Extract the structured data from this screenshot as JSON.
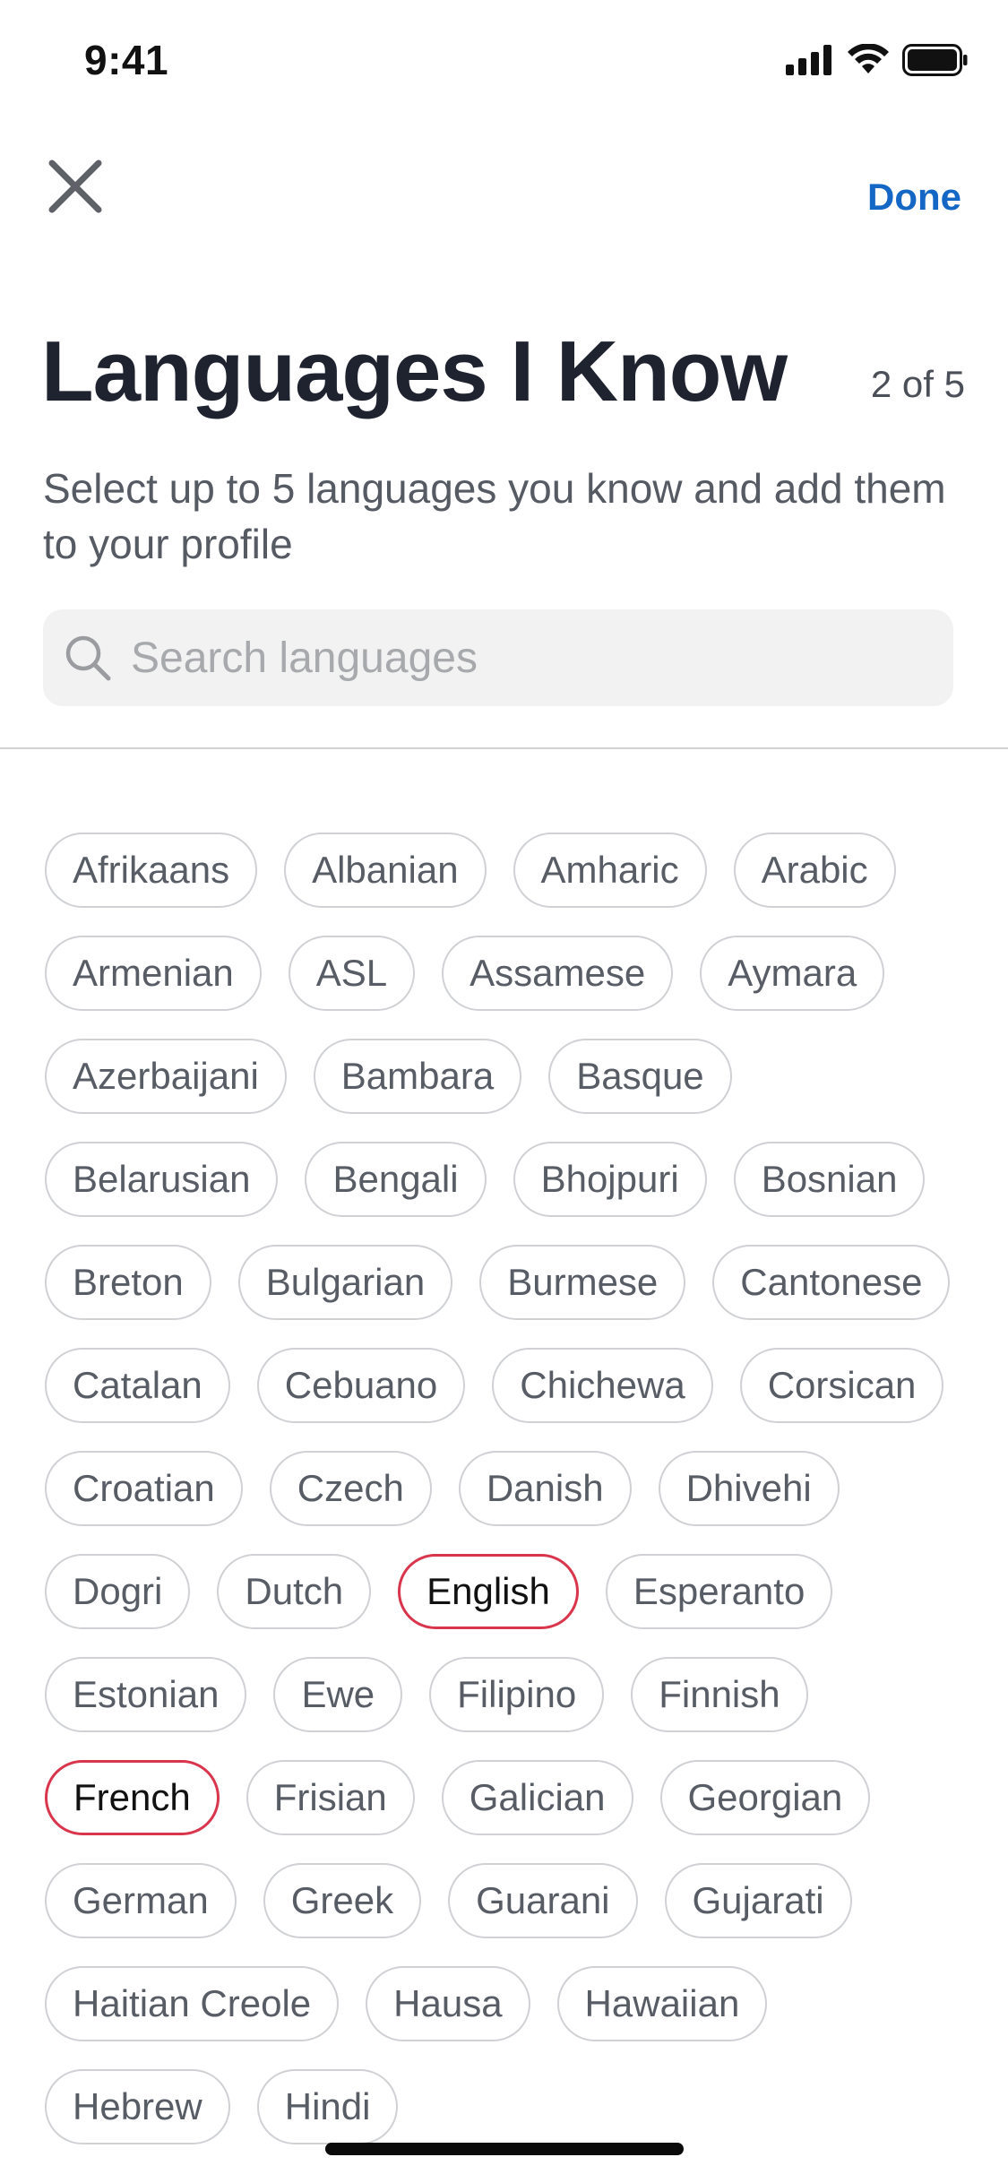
{
  "status_bar": {
    "time": "9:41"
  },
  "nav": {
    "done_label": "Done",
    "accent_color": "#1467c4"
  },
  "header": {
    "title": "Languages I Know",
    "counter": "2 of 5",
    "subtitle": "Select up to 5 languages you know and add them to your profile"
  },
  "search": {
    "placeholder": "Search languages",
    "value": ""
  },
  "selected_color": "#d9354c",
  "languages": [
    {
      "label": "Afrikaans",
      "selected": false
    },
    {
      "label": "Albanian",
      "selected": false
    },
    {
      "label": "Amharic",
      "selected": false
    },
    {
      "label": "Arabic",
      "selected": false
    },
    {
      "label": "Armenian",
      "selected": false
    },
    {
      "label": "ASL",
      "selected": false
    },
    {
      "label": "Assamese",
      "selected": false
    },
    {
      "label": "Aymara",
      "selected": false
    },
    {
      "label": "Azerbaijani",
      "selected": false
    },
    {
      "label": "Bambara",
      "selected": false
    },
    {
      "label": "Basque",
      "selected": false
    },
    {
      "label": "Belarusian",
      "selected": false
    },
    {
      "label": "Bengali",
      "selected": false
    },
    {
      "label": "Bhojpuri",
      "selected": false
    },
    {
      "label": "Bosnian",
      "selected": false
    },
    {
      "label": "Breton",
      "selected": false
    },
    {
      "label": "Bulgarian",
      "selected": false
    },
    {
      "label": "Burmese",
      "selected": false
    },
    {
      "label": "Cantonese",
      "selected": false
    },
    {
      "label": "Catalan",
      "selected": false
    },
    {
      "label": "Cebuano",
      "selected": false
    },
    {
      "label": "Chichewa",
      "selected": false
    },
    {
      "label": "Corsican",
      "selected": false
    },
    {
      "label": "Croatian",
      "selected": false
    },
    {
      "label": "Czech",
      "selected": false
    },
    {
      "label": "Danish",
      "selected": false
    },
    {
      "label": "Dhivehi",
      "selected": false
    },
    {
      "label": "Dogri",
      "selected": false
    },
    {
      "label": "Dutch",
      "selected": false
    },
    {
      "label": "English",
      "selected": true
    },
    {
      "label": "Esperanto",
      "selected": false
    },
    {
      "label": "Estonian",
      "selected": false
    },
    {
      "label": "Ewe",
      "selected": false
    },
    {
      "label": "Filipino",
      "selected": false
    },
    {
      "label": "Finnish",
      "selected": false
    },
    {
      "label": "French",
      "selected": true
    },
    {
      "label": "Frisian",
      "selected": false
    },
    {
      "label": "Galician",
      "selected": false
    },
    {
      "label": "Georgian",
      "selected": false
    },
    {
      "label": "German",
      "selected": false
    },
    {
      "label": "Greek",
      "selected": false
    },
    {
      "label": "Guarani",
      "selected": false
    },
    {
      "label": "Gujarati",
      "selected": false
    },
    {
      "label": "Haitian Creole",
      "selected": false
    },
    {
      "label": "Hausa",
      "selected": false
    },
    {
      "label": "Hawaiian",
      "selected": false
    },
    {
      "label": "Hebrew",
      "selected": false
    },
    {
      "label": "Hindi",
      "selected": false
    }
  ]
}
